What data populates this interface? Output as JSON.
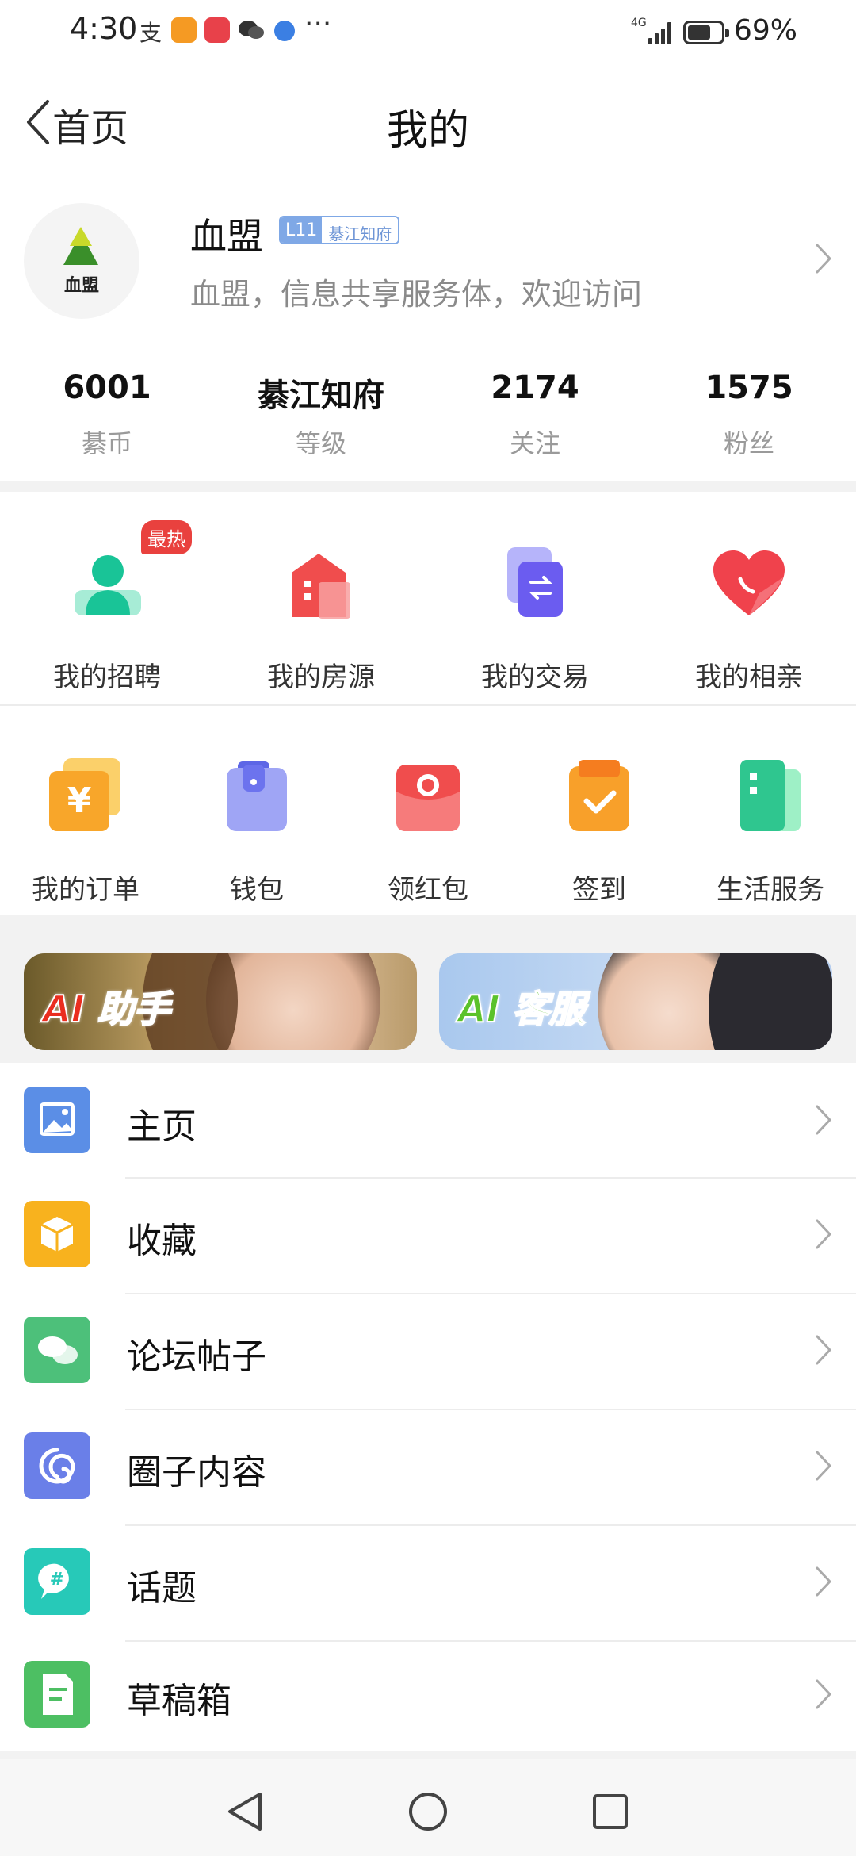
{
  "status_bar": {
    "time": "4:30",
    "network": "4G",
    "battery_percent": "69%",
    "battery_level": 0.69,
    "app_icons": [
      "alipay-icon",
      "video-app-icon",
      "huawei-store-icon",
      "wechat-icon",
      "browser-icon"
    ]
  },
  "header": {
    "back_label": "首页",
    "title": "我的"
  },
  "profile": {
    "avatar_text": "血盟",
    "username": "血盟",
    "level": "L11",
    "level_title": "綦江知府",
    "bio": "血盟，信息共享服务体，欢迎访问"
  },
  "stats": [
    {
      "value": "6001",
      "label": "綦币"
    },
    {
      "value": "綦江知府",
      "label": "等级"
    },
    {
      "value": "2174",
      "label": "关注"
    },
    {
      "value": "1575",
      "label": "粉丝"
    }
  ],
  "quick_actions": {
    "hot_badge": "最热",
    "items": [
      {
        "label": "我的招聘",
        "icon": "recruit-icon",
        "color": "#19c497"
      },
      {
        "label": "我的房源",
        "icon": "house-icon",
        "color": "#f04d4d"
      },
      {
        "label": "我的交易",
        "icon": "exchange-icon",
        "color": "#6b5cf0"
      },
      {
        "label": "我的相亲",
        "icon": "heart-icon",
        "color": "#f0424c"
      }
    ]
  },
  "tools": [
    {
      "label": "我的订单",
      "icon": "order-icon",
      "color": "#f8a62a"
    },
    {
      "label": "钱包",
      "icon": "wallet-icon",
      "color": "#7b83f2"
    },
    {
      "label": "领红包",
      "icon": "red-packet-icon",
      "color": "#f04d4d"
    },
    {
      "label": "签到",
      "icon": "checkin-icon",
      "color": "#f8a02a"
    },
    {
      "label": "生活服务",
      "icon": "life-service-icon",
      "color": "#2fc68f"
    }
  ],
  "banners": [
    {
      "text": "AI 助手",
      "icon": "ai-assistant-banner"
    },
    {
      "text": "AI 客服",
      "icon": "ai-service-banner"
    }
  ],
  "menu": [
    {
      "label": "主页",
      "icon": "image-icon",
      "color": "#5b8ee6"
    },
    {
      "label": "收藏",
      "icon": "box-icon",
      "color": "#f8b21e"
    },
    {
      "label": "论坛帖子",
      "icon": "chat-bubbles-icon",
      "color": "#4dc07a"
    },
    {
      "label": "圈子内容",
      "icon": "swirl-icon",
      "color": "#6a7fe8"
    },
    {
      "label": "话题",
      "icon": "hashtag-icon",
      "color": "#27c9b8"
    },
    {
      "label": "草稿箱",
      "icon": "draft-icon",
      "color": "#4dbf63"
    }
  ]
}
